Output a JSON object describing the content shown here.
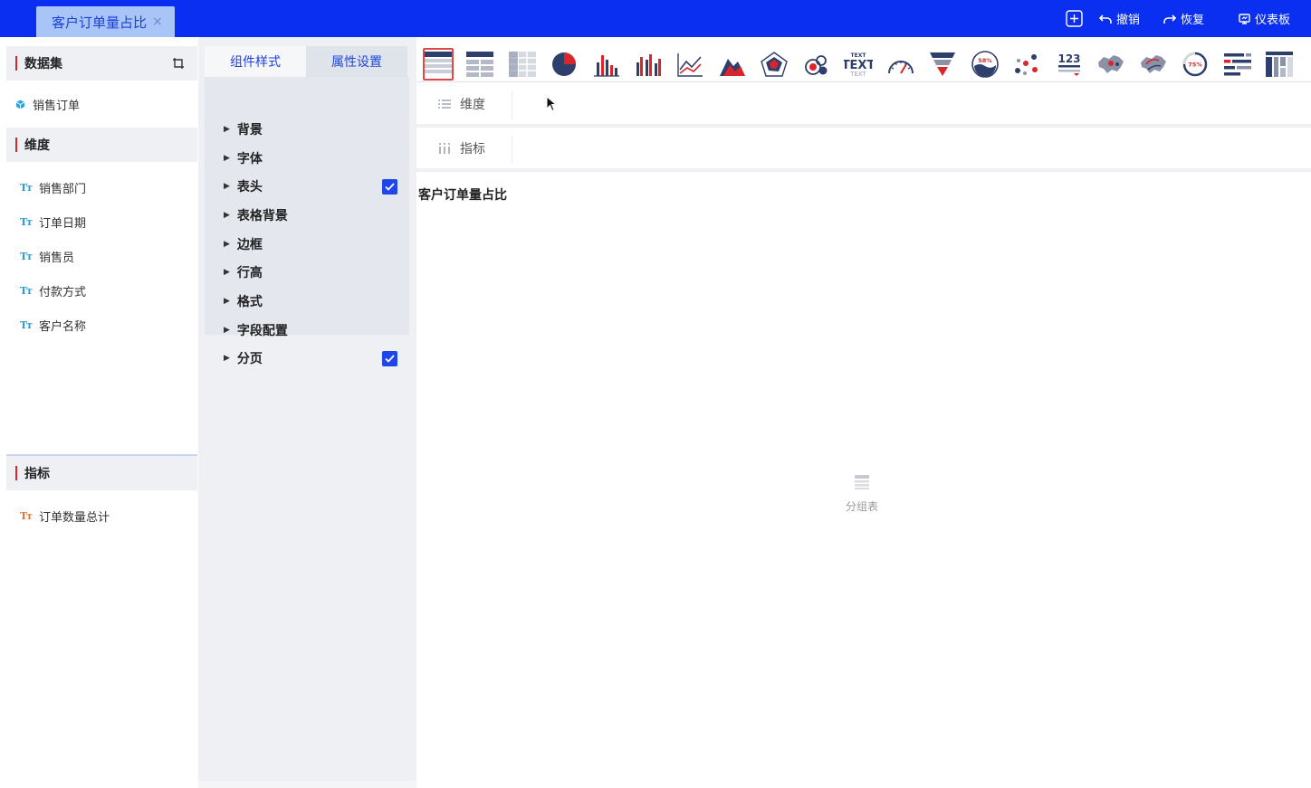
{
  "tab": {
    "title": "客户订单量占比",
    "close": "×"
  },
  "top_actions": {
    "undo": "撤销",
    "redo": "恢复",
    "dashboard": "仪表板"
  },
  "dataset": {
    "title": "数据集",
    "name": "销售订单"
  },
  "dimension": {
    "title": "维度",
    "fields": [
      "销售部门",
      "订单日期",
      "销售员",
      "付款方式",
      "客户名称"
    ]
  },
  "metric": {
    "title": "指标",
    "fields": [
      "订单数量总计"
    ]
  },
  "field_type_icon": "Tт",
  "panel_tabs": {
    "style": "组件样式",
    "props": "属性设置"
  },
  "style_items": [
    {
      "label": "背景",
      "checked": false
    },
    {
      "label": "字体",
      "checked": false
    },
    {
      "label": "表头",
      "checked": true
    },
    {
      "label": "表格背景",
      "checked": false
    },
    {
      "label": "边框",
      "checked": false
    },
    {
      "label": "行高",
      "checked": false
    },
    {
      "label": "格式",
      "checked": false
    },
    {
      "label": "字段配置",
      "checked": false
    },
    {
      "label": "分页",
      "checked": true
    }
  ],
  "chart_types": [
    "group-table-icon",
    "detail-table-icon",
    "cross-table-icon",
    "pie-chart-icon",
    "bar-chart-icon",
    "grouped-bar-chart-icon",
    "line-chart-icon",
    "area-chart-icon",
    "radar-chart-icon",
    "bubble-chart-icon",
    "text-card-icon",
    "gauge-chart-icon",
    "funnel-chart-icon",
    "water-ball-icon",
    "scatter-chart-icon",
    "kpi-number-icon",
    "map-chart-icon",
    "flow-map-icon",
    "progress-ring-icon",
    "ranking-bar-icon",
    "treemap-icon"
  ],
  "text_icon_labels": {
    "big": "TEXT",
    "small": "TEXT"
  },
  "water_ball_label": "58%",
  "progress_ring_label": "75%",
  "kpi_icon_label": "123",
  "drop_zones": {
    "dimension": "维度",
    "metric": "指标"
  },
  "chart_title": "客户订单量占比",
  "placeholder": "分组表",
  "colors": {
    "topbar": "#0a2ff0",
    "accent": "#1e46e8",
    "mark_red": "#d9262c",
    "icon_navy": "#2f3f6b"
  }
}
